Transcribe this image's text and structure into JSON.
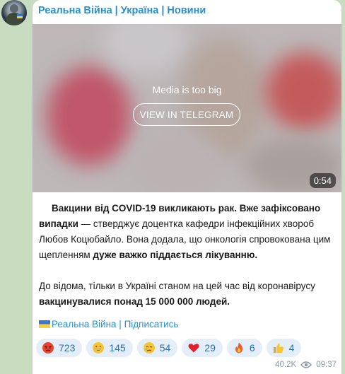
{
  "channel": {
    "name": "Реальна Війна | Україна | Новини"
  },
  "media": {
    "notice": "Media is too big",
    "button_label": "VIEW IN TELEGRAM",
    "duration": "0:54"
  },
  "post": {
    "p1_bold1": "Вакцини від COVID-19 викликають рак. Вже зафіксовано випадки",
    "p1_text1": " — стверджує доцентка кафедри інфекційних хвороб Любов Коцюбайло. Вона додала, що онкологія спровокована цим щепленням ",
    "p1_bold2": "дуже важко піддається лікуванню.",
    "p2_text1": "До відома, тільки в Україні станом на цей час від коронавірусу ",
    "p2_bold1": "вакцинувалися понад 15 000 000 людей."
  },
  "link": {
    "text": "Реальна Війна | Підписатись"
  },
  "reactions": [
    {
      "emoji": "angry-face-icon",
      "count": "723"
    },
    {
      "emoji": "grinning-face-icon",
      "count": "145"
    },
    {
      "emoji": "crying-face-icon",
      "count": "54"
    },
    {
      "emoji": "red-heart-icon",
      "count": "29"
    },
    {
      "emoji": "fire-icon",
      "count": "6"
    },
    {
      "emoji": "thumbs-up-icon",
      "count": "4"
    }
  ],
  "footer": {
    "views": "40.2K",
    "time": "09:37"
  },
  "colors": {
    "accent": "#2a8fd0",
    "reaction_bg": "#e4eef8",
    "reaction_text": "#2a6fb0",
    "chat_bg": "#c8dcc0"
  }
}
